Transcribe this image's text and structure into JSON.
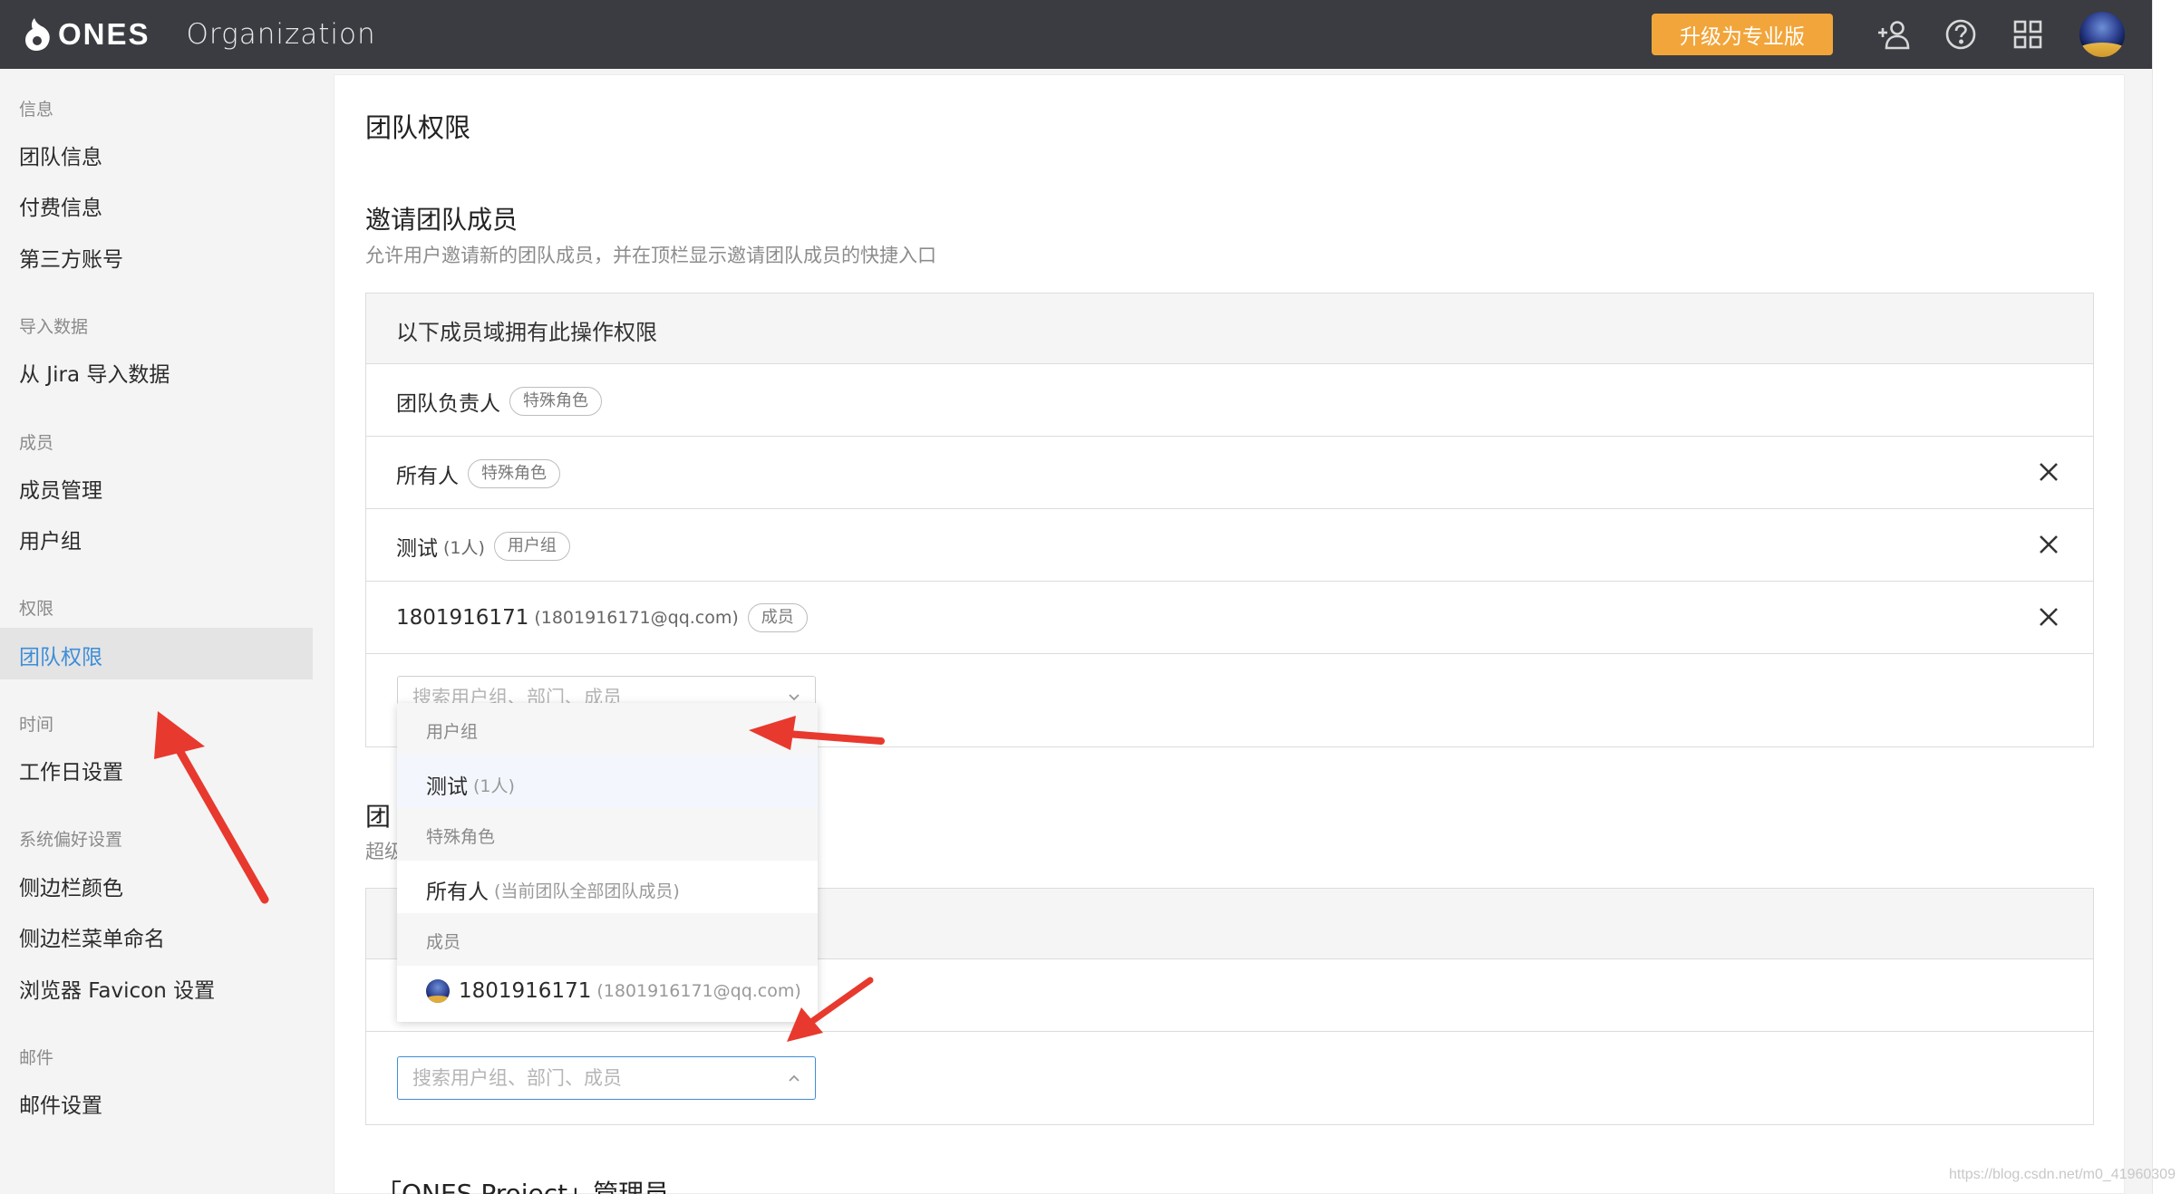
{
  "header": {
    "logo_text": "ONES",
    "org_title": "Organization",
    "upgrade_label": "升级为专业版",
    "icons": [
      "add-user-icon",
      "help-icon",
      "apps-grid-icon",
      "avatar"
    ]
  },
  "sidebar": {
    "groups": [
      {
        "title": "信息",
        "items": [
          "团队信息",
          "付费信息",
          "第三方账号"
        ]
      },
      {
        "title": "导入数据",
        "items": [
          "从 Jira 导入数据"
        ]
      },
      {
        "title": "成员",
        "items": [
          "成员管理",
          "用户组"
        ]
      },
      {
        "title": "权限",
        "items": [
          "团队权限"
        ]
      },
      {
        "title": "时间",
        "items": [
          "工作日设置"
        ]
      },
      {
        "title": "系统偏好设置",
        "items": [
          "侧边栏颜色",
          "侧边栏菜单命名",
          "浏览器 Favicon 设置"
        ]
      },
      {
        "title": "邮件",
        "items": [
          "邮件设置"
        ]
      }
    ],
    "active_item": "团队权限"
  },
  "main": {
    "page_title": "团队权限",
    "invite_section": {
      "title": "邀请团队成员",
      "description": "允许用户邀请新的团队成员，并在顶栏显示邀请团队成员的快捷入口",
      "table_header": "以下成员域拥有此操作权限",
      "rows": [
        {
          "name": "团队负责人",
          "sub": "",
          "tag": "特殊角色",
          "removable": false
        },
        {
          "name": "所有人",
          "sub": "",
          "tag": "特殊角色",
          "removable": true
        },
        {
          "name": "测试",
          "sub": "(1人)",
          "tag": "用户组",
          "removable": true
        },
        {
          "name": "1801916171",
          "sub": "(1801916171@qq.com)",
          "tag": "成员",
          "removable": true
        }
      ],
      "search_placeholder": "搜索用户组、部门、成员"
    },
    "section2": {
      "title_partial": "团",
      "desc_partial": "超级",
      "search_placeholder": "搜索用户组、部门、成员"
    },
    "section3": {
      "title": "「ONES Project」管理员"
    }
  },
  "dropdown": {
    "groups": [
      {
        "title": "用户组",
        "items": [
          {
            "label": "测试",
            "hint": "(1人)"
          }
        ]
      },
      {
        "title": "特殊角色",
        "items": [
          {
            "label": "所有人",
            "hint": "(当前团队全部团队成员)"
          }
        ]
      },
      {
        "title": "成员",
        "items": [
          {
            "label": "1801916171",
            "hint": "(1801916171@qq.com)"
          }
        ]
      }
    ]
  },
  "watermark": "https://blog.csdn.net/m0_41960309",
  "colors": {
    "topbar": "#3a3c41",
    "upgrade": "#f2a53a",
    "accent": "#3e8ed8",
    "arrow": "#e8392e"
  }
}
